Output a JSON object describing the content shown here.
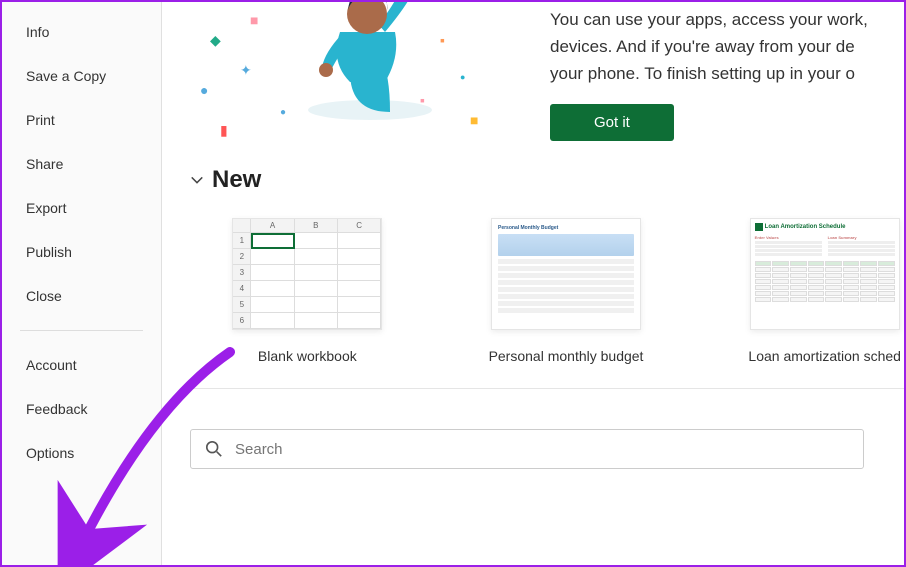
{
  "sidebar": {
    "items_top": [
      {
        "label": "Info",
        "name": "sidebar-item-info"
      },
      {
        "label": "Save a Copy",
        "name": "sidebar-item-save-copy"
      },
      {
        "label": "Print",
        "name": "sidebar-item-print"
      },
      {
        "label": "Share",
        "name": "sidebar-item-share"
      },
      {
        "label": "Export",
        "name": "sidebar-item-export"
      },
      {
        "label": "Publish",
        "name": "sidebar-item-publish"
      },
      {
        "label": "Close",
        "name": "sidebar-item-close"
      }
    ],
    "items_bottom": [
      {
        "label": "Account",
        "name": "sidebar-item-account"
      },
      {
        "label": "Feedback",
        "name": "sidebar-item-feedback"
      },
      {
        "label": "Options",
        "name": "sidebar-item-options"
      }
    ]
  },
  "banner": {
    "text_line1": "You can use your apps, access your work,",
    "text_line2": "devices. And if you're away from your de",
    "text_line3": "your phone. To finish setting up in your o",
    "button_label": "Got it"
  },
  "new_section": {
    "title": "New",
    "templates": [
      {
        "name": "Blank workbook"
      },
      {
        "name": "Personal monthly budget"
      },
      {
        "name": "Loan amortization sched"
      }
    ]
  },
  "search": {
    "placeholder": "Search"
  },
  "blank_thumb": {
    "cols": [
      "A",
      "B",
      "C"
    ],
    "rows": [
      "1",
      "2",
      "3",
      "4",
      "5",
      "6"
    ]
  },
  "budget_thumb": {
    "title": "Personal Monthly Budget"
  },
  "loan_thumb": {
    "title": "Loan Amortization Schedule",
    "h1": "Enter Values",
    "h2": "Loan Summary"
  }
}
